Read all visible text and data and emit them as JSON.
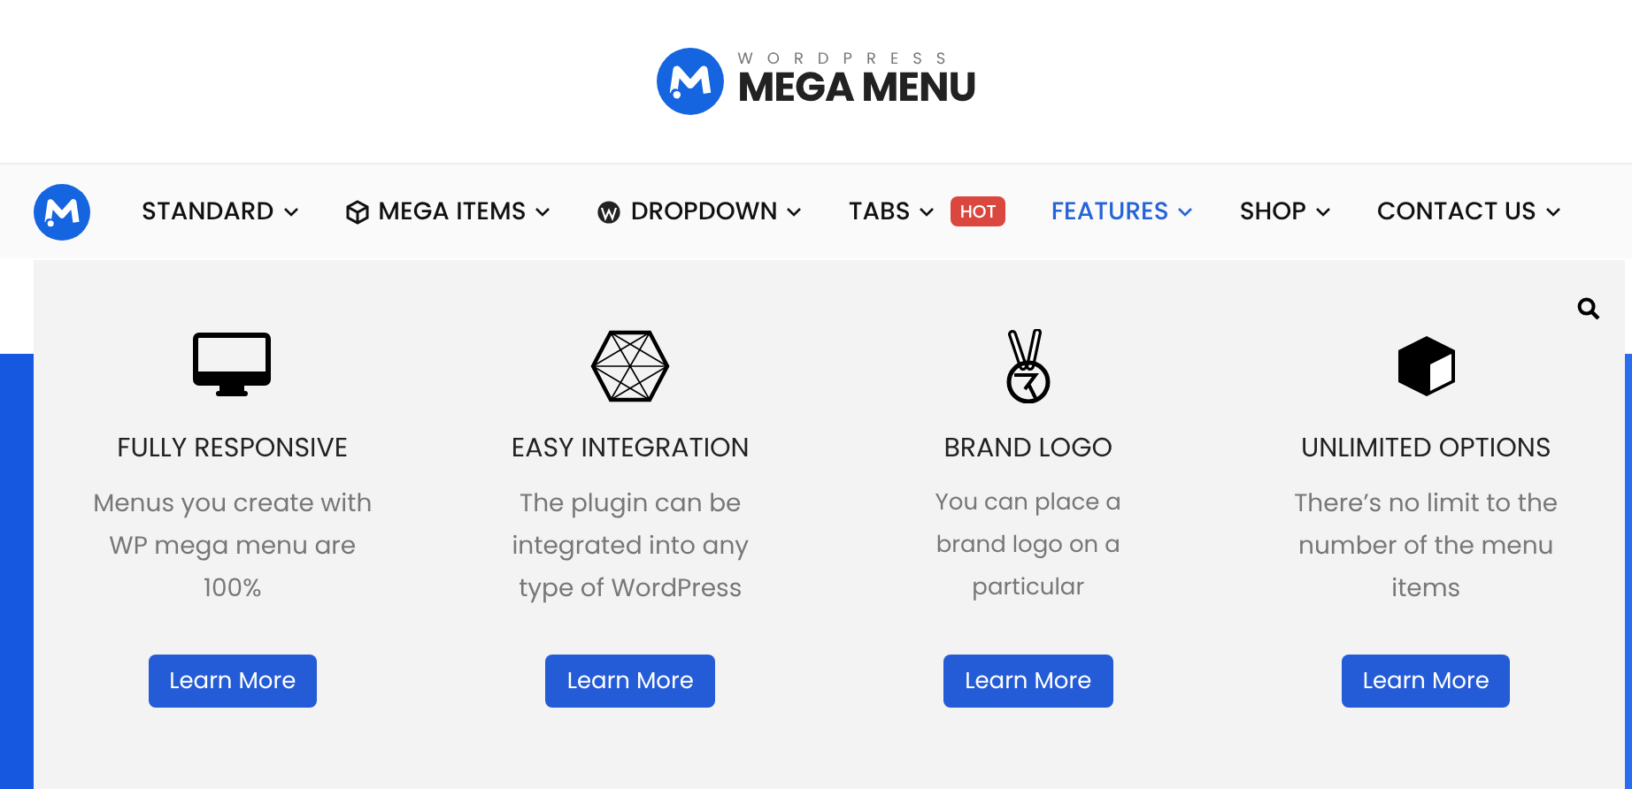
{
  "header": {
    "logo_top": "WORDPRESS",
    "logo_bottom": "MEGA MENU"
  },
  "nav": [
    {
      "label": "STANDARD",
      "selected": false
    },
    {
      "label": "MEGA ITEMS",
      "selected": false
    },
    {
      "label": "DROPDOWN",
      "selected": false
    },
    {
      "label": "TABS",
      "selected": false,
      "badge": "HOT"
    },
    {
      "label": "FEATURES",
      "selected": true
    },
    {
      "label": "SHOP",
      "selected": false
    },
    {
      "label": "CONTACT US",
      "selected": false
    }
  ],
  "features": [
    {
      "title": "FULLY RESPONSIVE",
      "text": "Menus you create with WP mega menu are 100%",
      "button": "Learn More"
    },
    {
      "title": "EASY INTEGRATION",
      "text": "The plugin can be integrated into any type of WordPress",
      "button": "Learn More"
    },
    {
      "title": "BRAND LOGO",
      "text": "You can place a brand logo on a particular",
      "button": "Learn More"
    },
    {
      "title": "UNLIMITED OPTIONS",
      "text": "There’s no limit to the number of the menu items",
      "button": "Learn More"
    }
  ]
}
